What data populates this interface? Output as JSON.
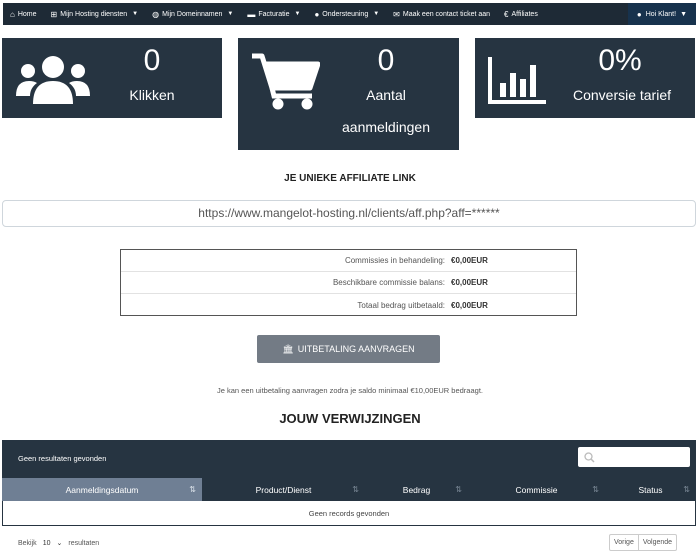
{
  "nav": {
    "home": "Home",
    "hosting": "Mijn Hosting diensten",
    "domains": "Mijn Domeinnamen",
    "billing": "Facturatie",
    "support": "Ondersteuning",
    "ticket": "Maak een contact ticket aan",
    "affiliates": "Affiliates",
    "user": "Hoi Klant!"
  },
  "stats": {
    "clicks": {
      "value": "0",
      "label": "Klikken",
      "icon": "users-icon"
    },
    "signups": {
      "value": "0",
      "label_line1": "Aantal",
      "label_line2": "aanmeldingen",
      "icon": "cart-icon"
    },
    "conversion": {
      "value": "0%",
      "label": "Conversie tarief",
      "icon": "bar-chart-icon"
    }
  },
  "affiliate": {
    "title": "JE UNIEKE AFFILIATE LINK",
    "link": "https://www.mangelot-hosting.nl/clients/aff.php?aff=******"
  },
  "commissions": [
    {
      "label": "Commissies in behandeling:",
      "value": "€0,00EUR"
    },
    {
      "label": "Beschikbare commissie balans:",
      "value": "€0,00EUR"
    },
    {
      "label": "Totaal bedrag uitbetaald:",
      "value": "€0,00EUR"
    }
  ],
  "payout": {
    "button": "UITBETALING AANVRAGEN",
    "note": "Je kan een uitbetaling aanvragen zodra je saldo minimaal €10,00EUR bedraagt."
  },
  "referrals": {
    "title": "JOUW VERWIJZINGEN",
    "empty_top": "Geen resultaten gevonden",
    "columns": [
      "Aanmeldingsdatum",
      "Product/Dienst",
      "Bedrag",
      "Commissie",
      "Status"
    ],
    "no_records": "Geen records gevonden",
    "show_label": "Bekijk",
    "page_size": "10",
    "results_label": "resultaten",
    "prev": "Vorige",
    "next": "Volgende"
  },
  "colors": {
    "dark": "#263441",
    "nav": "#1e2a36",
    "button": "#737b85",
    "active_col": "#6f7f94"
  }
}
